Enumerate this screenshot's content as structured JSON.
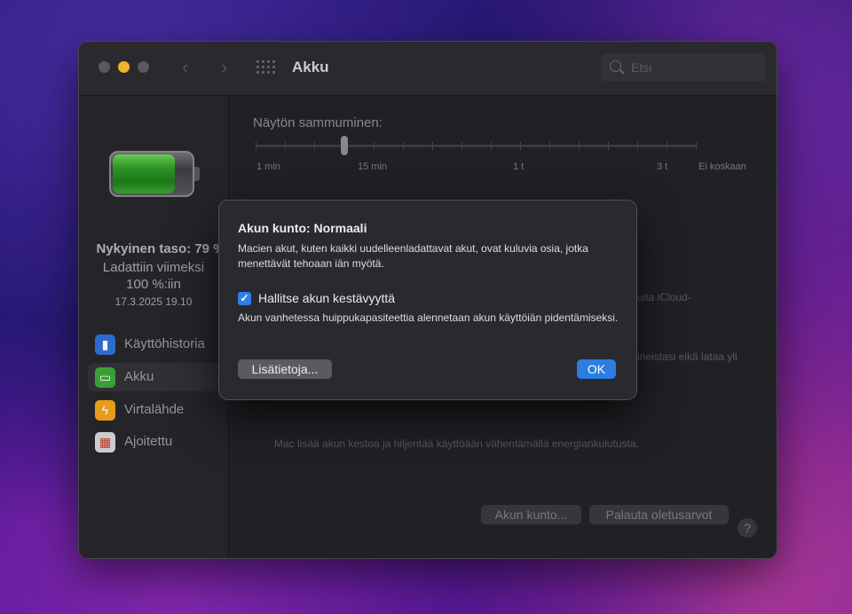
{
  "window": {
    "title": "Akku",
    "search_placeholder": "Etsi"
  },
  "sidebar": {
    "current_level": "Nykyinen taso: 79 %",
    "last_charged_line1": "Ladattiin viimeksi",
    "last_charged_line2": "100 %:iin",
    "last_charged_date": "17.3.2025 19.10",
    "items": [
      {
        "label": "Käyttöhistoria",
        "icon": "bar-chart-icon",
        "color": "#2f6fd6"
      },
      {
        "label": "Akku",
        "icon": "battery-icon",
        "color": "#3ea63a"
      },
      {
        "label": "Virtalähde",
        "icon": "lightning-icon",
        "color": "#f0a21c"
      },
      {
        "label": "Ajoitettu",
        "icon": "calendar-icon",
        "color": "#d5d4d9"
      }
    ],
    "selected": "Akku"
  },
  "main": {
    "sleep_label": "Näytön sammuminen:",
    "slider_labels": [
      "1 min",
      "15 min",
      "1 t",
      "3 t",
      "Ei koskaan"
    ],
    "slider_value": "15 min",
    "partial_text_1": "uita iCloud-",
    "partial_text_2": "ineistasi eikä lataa yli",
    "partial_text_3": "Mac lisää akun kestoa ja hiljentää käyttöään vähentämällä energiankulutusta."
  },
  "footer": {
    "battery_health_button": "Akun kunto...",
    "restore_defaults_button": "Palauta oletusarvot",
    "help_button": "?"
  },
  "dialog": {
    "title": "Akun kunto: Normaali",
    "body": "Macien akut, kuten kaikki uudelleenladattavat akut, ovat kuluvia osia, jotka menettävät tehoaan iän myötä.",
    "checkbox_label": "Hallitse akun kestävyyttä",
    "checkbox_checked": true,
    "note": "Akun vanhetessa huippukapasiteettia alennetaan akun käyttöiän pidentämiseksi.",
    "more_button": "Lisätietoja...",
    "ok_button": "OK"
  }
}
